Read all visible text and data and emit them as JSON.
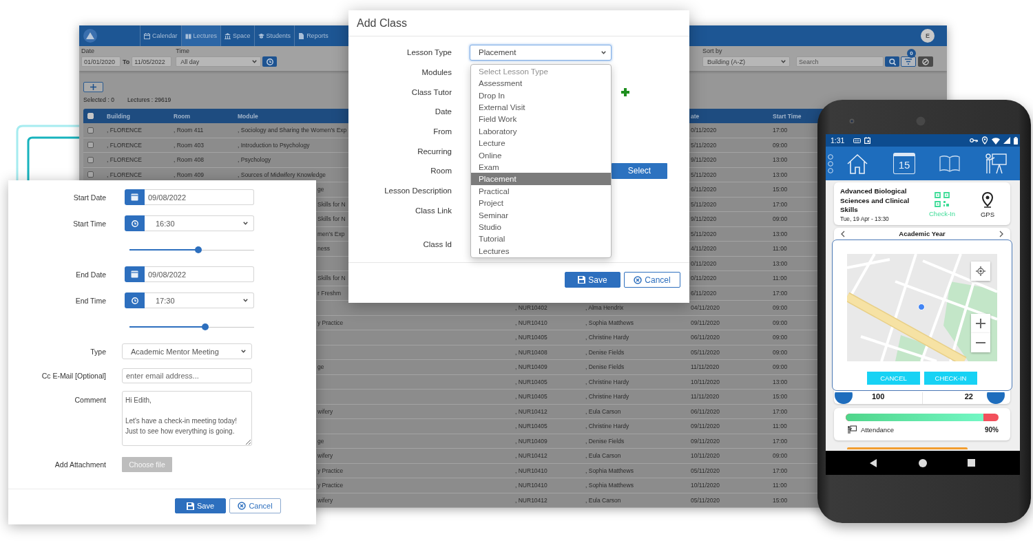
{
  "background_app": {
    "nav": [
      {
        "label": "Calendar",
        "selected": false
      },
      {
        "label": "Lectures",
        "selected": true
      },
      {
        "label": "Space",
        "selected": false
      },
      {
        "label": "Students",
        "selected": false
      },
      {
        "label": "Reports",
        "selected": false
      }
    ],
    "avatar": "E",
    "filters": {
      "date_label": "Date",
      "date_from": "01/01/2020",
      "to_label": "To",
      "date_to": "11/05/2022",
      "time_label": "Time",
      "time_value": "All day",
      "sort_label": "Sort by",
      "sort_value": "Building (A-Z)",
      "search_placeholder": "Search",
      "filter_count": "0"
    },
    "summary": {
      "selected": "Selected : 0",
      "lectures": "Lectures : 29619"
    },
    "table": {
      "select_all_checked": false,
      "columns": [
        "Building",
        "Room",
        "Module",
        "ate",
        "Start Time"
      ],
      "rows": [
        {
          "checked": false,
          "building": ", FLORENCE",
          "room": ", Room 411",
          "module": ", Sociology and Sharing the Women's Exp",
          "date": "0/11/2020",
          "start_time": "17:00"
        },
        {
          "checked": false,
          "building": ", FLORENCE",
          "room": ", Room 403",
          "module": ", Introduction to Psychology",
          "date": "5/11/2020",
          "start_time": "09:00"
        },
        {
          "checked": false,
          "building": ", FLORENCE",
          "room": ", Room 408",
          "module": ", Psychology",
          "date": "9/11/2020",
          "start_time": "13:00"
        },
        {
          "checked": false,
          "building": ", FLORENCE",
          "room": ", Room 409",
          "module": ", Sources of Midwifery Knowledge",
          "date": "5/11/2020",
          "start_time": "13:00"
        },
        {
          "module": "ge",
          "date": "6/11/2020",
          "start_time": "15:00"
        },
        {
          "module": "Skills for N",
          "date": "5/11/2020",
          "start_time": "17:00"
        },
        {
          "module": "Skills for N",
          "date": "9/11/2020",
          "start_time": "09:00"
        },
        {
          "module": "men's Exp",
          "date": "5/11/2020",
          "start_time": "13:00"
        },
        {
          "module": "ness",
          "date": "4/11/2020",
          "start_time": "11:00"
        },
        {
          "date": "0/11/2020",
          "start_time": "13:00"
        },
        {
          "module": "Skills for N",
          "date": "0/11/2020",
          "start_time": "11:00"
        },
        {
          "module": "r Freshm",
          "date": "6/11/2020",
          "start_time": "17:00"
        },
        {
          "column_4": ", NUR10402",
          "column_5": ", Alma Hendrix",
          "date": "04/11/2020",
          "start_time": "09:00"
        },
        {
          "module": "y Practice",
          "column_4": ", NUR10410",
          "column_5": ", Sophia Matthews",
          "date": "09/11/2020",
          "start_time": "09:00"
        },
        {
          "column_4": ", NUR10405",
          "column_5": ", Christine Hardy",
          "date": "06/11/2020",
          "start_time": "09:00"
        },
        {
          "column_4": ", NUR10408",
          "column_5": ", Denise Fields",
          "date": "05/11/2020",
          "start_time": "09:00"
        },
        {
          "module": "ge",
          "column_4": ", NUR10409",
          "column_5": ", Denise Fields",
          "date": "11/11/2020",
          "start_time": "09:00"
        },
        {
          "column_4": ", NUR10405",
          "column_5": ", Christine Hardy",
          "date": "10/11/2020",
          "start_time": "13:00"
        },
        {
          "column_4": ", NUR10405",
          "column_5": ", Christine Hardy",
          "date": "11/11/2020",
          "start_time": "15:00"
        },
        {
          "module": "wifery",
          "column_4": ", NUR10412",
          "column_5": ", Eula Carson",
          "date": "06/11/2020",
          "start_time": "17:00"
        },
        {
          "column_4": ", NUR10405",
          "column_5": ", Christine Hardy",
          "date": "09/11/2020",
          "start_time": "11:00"
        },
        {
          "module": "ge",
          "column_4": ", NUR10409",
          "column_5": ", Denise Fields",
          "date": "09/11/2020",
          "start_time": "17:00"
        },
        {
          "module": "wifery",
          "column_4": ", NUR10412",
          "column_5": ", Eula Carson",
          "date": "10/11/2020",
          "start_time": "09:00"
        },
        {
          "module": "y Practice",
          "column_4": ", NUR10410",
          "column_5": ", Sophia Matthews",
          "date": "05/11/2020",
          "start_time": "17:00"
        },
        {
          "module": "y Practice",
          "column_4": ", NUR10410",
          "column_5": ", Sophia Matthews",
          "date": "10/11/2020",
          "start_time": "11:00"
        },
        {
          "module": "wifery",
          "column_4": ", NUR10412",
          "column_5": ", Eula Carson",
          "date": "05/11/2020",
          "start_time": "15:00"
        }
      ]
    }
  },
  "add_class": {
    "title": "Add Class",
    "fields": [
      {
        "label": "Lesson Type",
        "kind": "select",
        "value": "Placement",
        "expanded": true,
        "options": [
          {
            "label": "Select Lesson Type",
            "selected": false,
            "disabled": true
          },
          {
            "label": "Assessment",
            "selected": false,
            "disabled": false
          },
          {
            "label": "Drop In",
            "selected": false,
            "disabled": false
          },
          {
            "label": "External Visit",
            "selected": false,
            "disabled": false
          },
          {
            "label": "Field Work",
            "selected": false,
            "disabled": false
          },
          {
            "label": "Laboratory",
            "selected": false,
            "disabled": false
          },
          {
            "label": "Lecture",
            "selected": false,
            "disabled": false
          },
          {
            "label": "Online",
            "selected": false,
            "disabled": false
          },
          {
            "label": "Exam",
            "selected": false,
            "disabled": false
          },
          {
            "label": "Placement",
            "selected": true,
            "disabled": false
          },
          {
            "label": "Practical",
            "selected": false,
            "disabled": false
          },
          {
            "label": "Project",
            "selected": false,
            "disabled": false
          },
          {
            "label": "Seminar",
            "selected": false,
            "disabled": false
          },
          {
            "label": "Studio",
            "selected": false,
            "disabled": false
          },
          {
            "label": "Tutorial",
            "selected": false,
            "disabled": false
          },
          {
            "label": "Lectures",
            "selected": false,
            "disabled": false
          }
        ]
      },
      {
        "label": "Modules"
      },
      {
        "label": "Class Tutor",
        "kind": "add"
      },
      {
        "label": "Date"
      },
      {
        "label": "From"
      },
      {
        "label": "Recurring"
      },
      {
        "label": "Room",
        "kind": "picker",
        "button": "Select"
      },
      {
        "label": "Lesson Description"
      },
      {
        "label": "Class Link"
      },
      {
        "label": "Class Id"
      }
    ],
    "buttons": {
      "save": "Save",
      "cancel": "Cancel"
    }
  },
  "meeting_form": {
    "fields": [
      {
        "kind": "date",
        "label": "Start Date",
        "value": "09/08/2022"
      },
      {
        "kind": "time",
        "label": "Start Time",
        "value": "16:30",
        "level": 0.55
      },
      {
        "kind": "date",
        "label": "End Date",
        "value": "09/08/2022"
      },
      {
        "kind": "time",
        "label": "End Time",
        "value": "17:30",
        "level": 0.61
      },
      {
        "kind": "select",
        "label": "Type",
        "value": "Academic Mentor Meeting"
      },
      {
        "kind": "text",
        "label": "Cc E-Mail [Optional]",
        "placeholder": "enter email address..."
      },
      {
        "kind": "textarea",
        "label": "Comment",
        "value": "Hi Edith,\n\nLet's have a check-in meeting today!\nJust to see how everything is going."
      },
      {
        "kind": "file",
        "label": "Add Attachment",
        "button": "Choose file",
        "disabled": true
      }
    ],
    "buttons": {
      "save": "Save",
      "cancel": "Cancel"
    }
  },
  "phone": {
    "status_time": "1:31",
    "calendar_day": "15",
    "course": {
      "title": "Advanced Biological Sciences and Clinical Skills",
      "time": "Tue, 19 Apr - 13:30",
      "actions": [
        {
          "kind": "qr",
          "label": "Check-In"
        },
        {
          "kind": "gps",
          "label": "GPS"
        }
      ]
    },
    "academic_year": "Academic Year",
    "map_dialog": {
      "buttons": [
        "CANCEL",
        "CHECK-IN"
      ]
    },
    "stats": [
      "100",
      "22"
    ],
    "attendance": {
      "label": "Attendance",
      "value": "90%",
      "level": 0.9
    }
  }
}
